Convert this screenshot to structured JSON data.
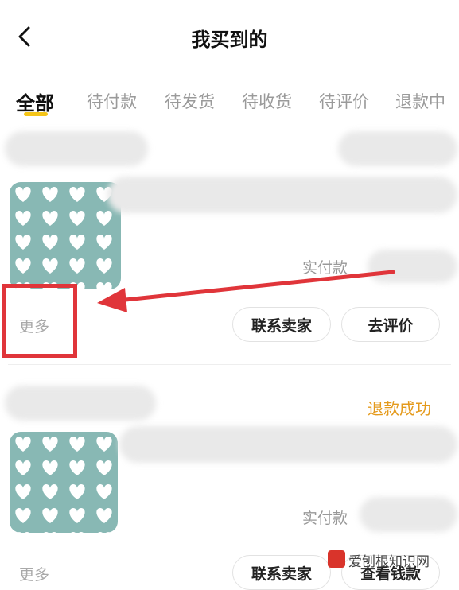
{
  "header": {
    "title": "我买到的"
  },
  "tabs": [
    {
      "label": "全部",
      "active": true
    },
    {
      "label": "待付款"
    },
    {
      "label": "待发货"
    },
    {
      "label": "待收货"
    },
    {
      "label": "待评价"
    },
    {
      "label": "退款中"
    }
  ],
  "orders": [
    {
      "paid_label": "实付款",
      "more_label": "更多",
      "buttons": [
        "联系卖家",
        "去评价"
      ]
    },
    {
      "status": "退款成功",
      "paid_label": "实付款",
      "more_label": "更多",
      "buttons": [
        "联系卖家",
        "查看钱款"
      ]
    }
  ],
  "watermark": "爱刨根知识网",
  "colors": {
    "accent": "#f5c518",
    "annotation": "#e0353a",
    "status": "#e49a1c",
    "thumb": "#88b8b4"
  }
}
